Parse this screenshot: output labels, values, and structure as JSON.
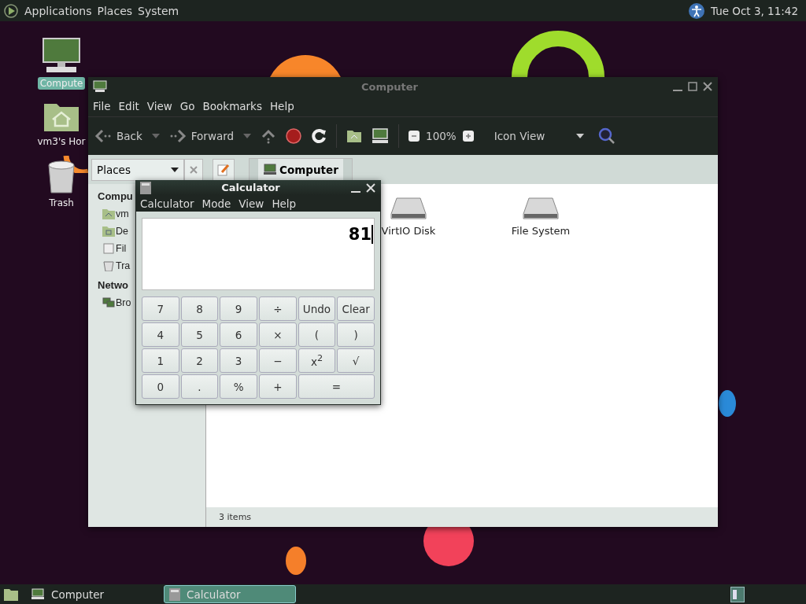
{
  "top_panel": {
    "menus": [
      "Applications",
      "Places",
      "System"
    ],
    "clock": "Tue Oct 3, 11:42"
  },
  "desktop_icons": [
    {
      "kind": "computer",
      "label": "Compute",
      "selected": true
    },
    {
      "kind": "home",
      "label": "vm3's Hor",
      "selected": false
    },
    {
      "kind": "trash",
      "label": "Trash",
      "selected": false
    }
  ],
  "file_manager": {
    "title": "Computer",
    "menus": [
      "File",
      "Edit",
      "View",
      "Go",
      "Bookmarks",
      "Help"
    ],
    "toolbar": {
      "back": "Back",
      "forward": "Forward",
      "zoom": "100%",
      "view": "Icon View"
    },
    "location": {
      "side_pane": "Places",
      "path": "Computer"
    },
    "sidebar": [
      {
        "heading": "Compu",
        "items": [
          {
            "kind": "home",
            "label": "vm"
          },
          {
            "kind": "desktop",
            "label": "De"
          },
          {
            "kind": "drive",
            "label": "Fil"
          },
          {
            "kind": "trash",
            "label": "Tra"
          }
        ]
      },
      {
        "heading": "Netwo",
        "items": [
          {
            "kind": "network",
            "label": "Bro"
          }
        ]
      }
    ],
    "files": [
      {
        "kind": "disk",
        "label": "VirtIO Disk"
      },
      {
        "kind": "disk",
        "label": "File System"
      }
    ],
    "status": "3 items"
  },
  "calculator": {
    "title": "Calculator",
    "menus": [
      "Calculator",
      "Mode",
      "View",
      "Help"
    ],
    "display": "81",
    "buttons": [
      {
        "label": "7",
        "kind": "key"
      },
      {
        "label": "8",
        "kind": "key"
      },
      {
        "label": "9",
        "kind": "key"
      },
      {
        "label": "÷",
        "kind": "key"
      },
      {
        "label": "Undo",
        "kind": "key"
      },
      {
        "label": "Clear",
        "kind": "key"
      },
      {
        "label": "4",
        "kind": "key"
      },
      {
        "label": "5",
        "kind": "key"
      },
      {
        "label": "6",
        "kind": "key"
      },
      {
        "label": "×",
        "kind": "key"
      },
      {
        "label": "(",
        "kind": "key"
      },
      {
        "label": ")",
        "kind": "key"
      },
      {
        "label": "1",
        "kind": "key"
      },
      {
        "label": "2",
        "kind": "key"
      },
      {
        "label": "3",
        "kind": "key"
      },
      {
        "label": "−",
        "kind": "key"
      },
      {
        "label": "x$^{2}$",
        "kind": "key"
      },
      {
        "label": "√",
        "kind": "key"
      },
      {
        "label": "0",
        "kind": "key"
      },
      {
        "label": ".",
        "kind": "key"
      },
      {
        "label": "%",
        "kind": "key"
      },
      {
        "label": "+",
        "kind": "key"
      },
      {
        "label": "=",
        "kind": "wide"
      }
    ]
  },
  "taskbar": [
    {
      "label": "Computer",
      "selected": false
    },
    {
      "label": "Calculator",
      "selected": true
    }
  ]
}
